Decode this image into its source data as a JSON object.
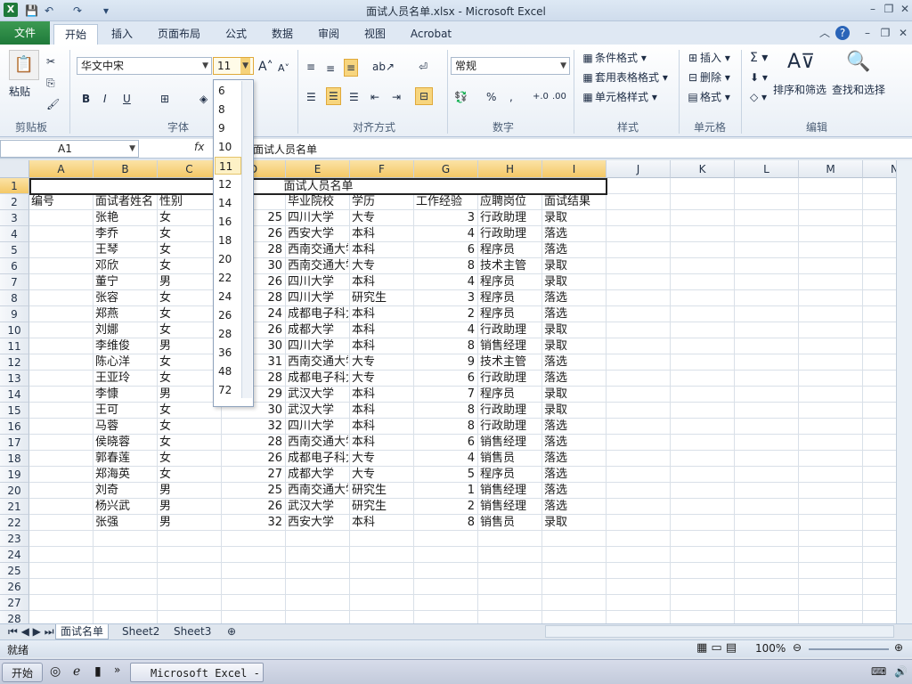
{
  "window": {
    "title": "面试人员名单.xlsx - Microsoft Excel",
    "app_icon": "X"
  },
  "ribbon_tabs": [
    {
      "label": "文件"
    },
    {
      "label": "开始"
    },
    {
      "label": "插入"
    },
    {
      "label": "页面布局"
    },
    {
      "label": "公式"
    },
    {
      "label": "数据"
    },
    {
      "label": "审阅"
    },
    {
      "label": "视图"
    },
    {
      "label": "Acrobat"
    }
  ],
  "ribbon": {
    "clipboard": {
      "paste": "粘贴",
      "label": "剪贴板"
    },
    "font": {
      "name": "华文中宋",
      "size": "11",
      "label": "字体"
    },
    "alignment": {
      "label": "对齐方式"
    },
    "number": {
      "format": "常规",
      "label": "数字"
    },
    "styles": {
      "cond": "条件格式",
      "table": "套用表格格式",
      "cell": "单元格样式",
      "label": "样式"
    },
    "cells": {
      "insert": "插入",
      "delete": "删除",
      "format": "格式",
      "label": "单元格"
    },
    "editing": {
      "sort": "排序和筛选",
      "find": "查找和选择",
      "label": "编辑"
    }
  },
  "formula_bar": {
    "name_box": "A1",
    "fx": "fx",
    "content": "面试人员名单"
  },
  "font_size_dropdown": [
    "6",
    "8",
    "9",
    "10",
    "11",
    "12",
    "14",
    "16",
    "18",
    "20",
    "22",
    "24",
    "26",
    "28",
    "36",
    "48",
    "72"
  ],
  "columns": [
    "A",
    "B",
    "C",
    "D",
    "E",
    "F",
    "G",
    "H",
    "I",
    "J",
    "K",
    "L",
    "M",
    "N"
  ],
  "title_cell": "面试人员名单",
  "headers": [
    "编号",
    "面试者姓名",
    "性别",
    "",
    "毕业院校",
    "学历",
    "工作经验",
    "应聘岗位",
    "面试结果"
  ],
  "rows": [
    {
      "name": "张艳",
      "sex": "女",
      "age": "25",
      "school": "四川大学",
      "edu": "大专",
      "exp": "3",
      "post": "行政助理",
      "result": "录取"
    },
    {
      "name": "李乔",
      "sex": "女",
      "age": "26",
      "school": "西安大学",
      "edu": "本科",
      "exp": "4",
      "post": "行政助理",
      "result": "落选"
    },
    {
      "name": "王琴",
      "sex": "女",
      "age": "28",
      "school": "西南交通大学",
      "edu": "本科",
      "exp": "6",
      "post": "程序员",
      "result": "落选"
    },
    {
      "name": "邓欣",
      "sex": "女",
      "age": "30",
      "school": "西南交通大学",
      "edu": "大专",
      "exp": "8",
      "post": "技术主管",
      "result": "录取"
    },
    {
      "name": "董宁",
      "sex": "男",
      "age": "26",
      "school": "四川大学",
      "edu": "本科",
      "exp": "4",
      "post": "程序员",
      "result": "录取"
    },
    {
      "name": "张容",
      "sex": "女",
      "age": "28",
      "school": "四川大学",
      "edu": "研究生",
      "exp": "3",
      "post": "程序员",
      "result": "落选"
    },
    {
      "name": "郑燕",
      "sex": "女",
      "age": "24",
      "school": "成都电子科大",
      "edu": "本科",
      "exp": "2",
      "post": "程序员",
      "result": "落选"
    },
    {
      "name": "刘娜",
      "sex": "女",
      "age": "26",
      "school": "成都大学",
      "edu": "本科",
      "exp": "4",
      "post": "行政助理",
      "result": "录取"
    },
    {
      "name": "李维俊",
      "sex": "男",
      "age": "30",
      "school": "四川大学",
      "edu": "本科",
      "exp": "8",
      "post": "销售经理",
      "result": "录取"
    },
    {
      "name": "陈心洋",
      "sex": "女",
      "age": "31",
      "school": "西南交通大学",
      "edu": "大专",
      "exp": "9",
      "post": "技术主管",
      "result": "落选"
    },
    {
      "name": "王亚玲",
      "sex": "女",
      "age": "28",
      "school": "成都电子科大",
      "edu": "大专",
      "exp": "6",
      "post": "行政助理",
      "result": "落选"
    },
    {
      "name": "李慷",
      "sex": "男",
      "age": "29",
      "school": "武汉大学",
      "edu": "本科",
      "exp": "7",
      "post": "程序员",
      "result": "录取"
    },
    {
      "name": "王可",
      "sex": "女",
      "age": "30",
      "school": "武汉大学",
      "edu": "本科",
      "exp": "8",
      "post": "行政助理",
      "result": "录取"
    },
    {
      "name": "马蓉",
      "sex": "女",
      "age": "32",
      "school": "四川大学",
      "edu": "本科",
      "exp": "8",
      "post": "行政助理",
      "result": "落选"
    },
    {
      "name": "侯晓蓉",
      "sex": "女",
      "age": "28",
      "school": "西南交通大学",
      "edu": "本科",
      "exp": "6",
      "post": "销售经理",
      "result": "落选"
    },
    {
      "name": "郭春莲",
      "sex": "女",
      "age": "26",
      "school": "成都电子科大",
      "edu": "大专",
      "exp": "4",
      "post": "销售员",
      "result": "落选"
    },
    {
      "name": "郑海英",
      "sex": "女",
      "age": "27",
      "school": "成都大学",
      "edu": "大专",
      "exp": "5",
      "post": "程序员",
      "result": "落选"
    },
    {
      "name": "刘奇",
      "sex": "男",
      "age": "25",
      "school": "西南交通大学",
      "edu": "研究生",
      "exp": "1",
      "post": "销售经理",
      "result": "落选"
    },
    {
      "name": "杨兴武",
      "sex": "男",
      "age": "26",
      "school": "武汉大学",
      "edu": "研究生",
      "exp": "2",
      "post": "销售经理",
      "result": "落选"
    },
    {
      "name": "张强",
      "sex": "男",
      "age": "32",
      "school": "西安大学",
      "edu": "本科",
      "exp": "8",
      "post": "销售员",
      "result": "录取"
    }
  ],
  "row_numbers": [
    "1",
    "2",
    "3",
    "4",
    "5",
    "6",
    "7",
    "8",
    "9",
    "10",
    "11",
    "12",
    "13",
    "14",
    "15",
    "16",
    "17",
    "18",
    "19",
    "20",
    "21",
    "22",
    "23",
    "24",
    "25",
    "26",
    "27",
    "28"
  ],
  "sheets": [
    "面试名单",
    "Sheet2",
    "Sheet3"
  ],
  "status": {
    "ready": "就绪",
    "zoom": "100%"
  },
  "taskbar": {
    "start": "开始",
    "item": "Microsoft Excel - ..."
  }
}
